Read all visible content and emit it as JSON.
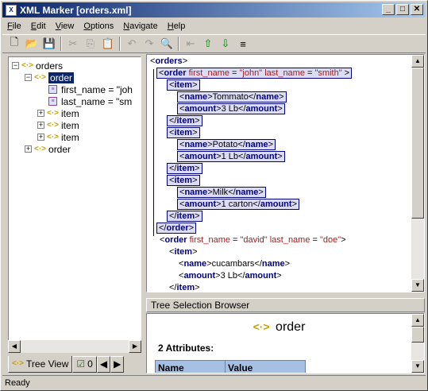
{
  "window": {
    "title": "XML Marker [orders.xml]",
    "min": "_",
    "max": "□",
    "close": "✕"
  },
  "menu": [
    {
      "pre": "",
      "u": "F",
      "post": "ile"
    },
    {
      "pre": "",
      "u": "E",
      "post": "dit"
    },
    {
      "pre": "",
      "u": "V",
      "post": "iew"
    },
    {
      "pre": "",
      "u": "O",
      "post": "ptions"
    },
    {
      "pre": "",
      "u": "N",
      "post": "avigate"
    },
    {
      "pre": "",
      "u": "H",
      "post": "elp"
    }
  ],
  "toolbar": {
    "new": "🗋",
    "open": "📂",
    "save": "💾",
    "cut": "✂",
    "copy": "⎘",
    "paste": "📋",
    "undo": "↶",
    "redo": "↷",
    "find": "🔍",
    "nav1": "⇤",
    "nav2": "⇧",
    "nav3": "⇩",
    "nav4": "≡"
  },
  "tree": {
    "root": "orders",
    "order_selected": "order",
    "attr1": "first_name = \"joh",
    "attr2": "last_name = \"sm",
    "item1": "item",
    "item2": "item",
    "item3": "item",
    "order2": "order"
  },
  "tabs": {
    "tree_view": "Tree View",
    "second": "0"
  },
  "xml": {
    "l1_open": "<",
    "l1_tag": "orders",
    "l1_close": ">",
    "l2_tag": "order",
    "l2_a1": "first_name",
    "l2_v1": "\"john\"",
    "l2_a2": "last_name",
    "l2_v2": "\"smith\"",
    "item": "item",
    "name": "name",
    "amount": "amount",
    "v_tommato": "Tommato",
    "v_3lb": "3 Lb",
    "v_potato": "Potato",
    "v_1lb": "1 Lb",
    "v_milk": "Milk",
    "v_1carton": "1 carton",
    "l4_a1": "first_name",
    "l4_v1": "\"david\"",
    "l4_a2": "last_name",
    "l4_v2": "\"doe\"",
    "v_cucambars": "cucambars",
    "v_3lb2": "3 Lb"
  },
  "browser": {
    "header": "Tree Selection Browser",
    "element": "order",
    "attrs_label": "2 Attributes:",
    "col_name": "Name",
    "col_value": "Value"
  },
  "status": {
    "text": "Ready"
  }
}
